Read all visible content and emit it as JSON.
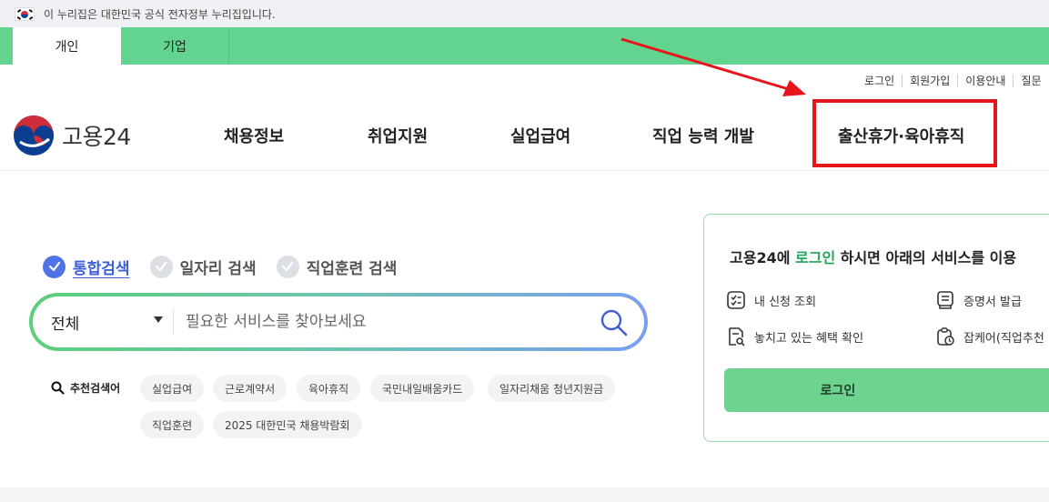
{
  "gov_banner": {
    "text": "이 누리집은 대한민국 공식 전자정부 누리집입니다."
  },
  "tabs": [
    {
      "label": "개인",
      "active": true
    },
    {
      "label": "기업",
      "active": false
    }
  ],
  "util_links": [
    "로그인",
    "회원가입",
    "이용안내",
    "질문"
  ],
  "logo": {
    "text": "고용24"
  },
  "gnb": [
    "채용정보",
    "취업지원",
    "실업급여",
    "직업 능력 개발",
    "출산휴가·육아휴직"
  ],
  "search": {
    "options": [
      {
        "label": "통합검색",
        "checked": true
      },
      {
        "label": "일자리 검색",
        "checked": false
      },
      {
        "label": "직업훈련 검색",
        "checked": false
      }
    ],
    "category": "전체",
    "placeholder": "필요한 서비스를 찾아보세요",
    "value": ""
  },
  "recommended": {
    "label": "추천검색어",
    "keywords": [
      "실업급여",
      "근로계약서",
      "육아휴직",
      "국민내일배움카드",
      "일자리채움 청년지원금",
      "직업훈련",
      "2025 대한민국 채용박람회"
    ]
  },
  "login_panel": {
    "message_prefix": "고용24에 ",
    "message_highlight": "로그인",
    "message_suffix": " 하시면 아래의 서비스를 이용",
    "services": [
      "내 신청 조회",
      "증명서 발급",
      "놓치고 있는 혜택 확인",
      "잡케어(직업추천"
    ],
    "button_label": "로그인"
  },
  "colors": {
    "brand_green": "#63d490",
    "check_blue": "#4f73e6",
    "highlight_green": "#22a35a",
    "annotation_red": "#e8141b"
  }
}
